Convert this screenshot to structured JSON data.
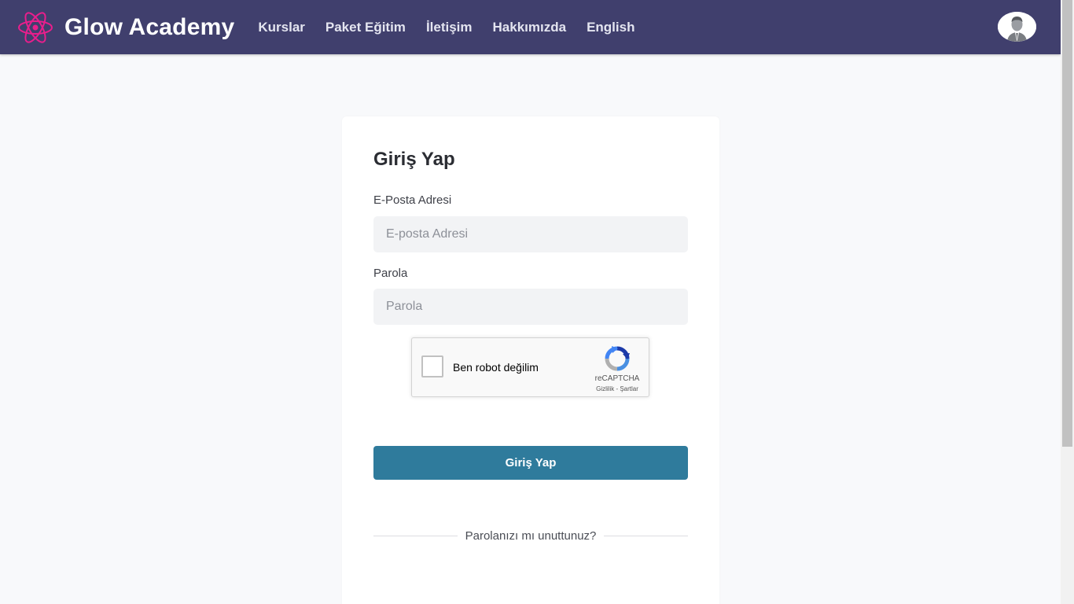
{
  "header": {
    "brand": "Glow Academy",
    "brand_color": "#e91e8c",
    "background": "#403f6d",
    "nav": [
      {
        "label": "Kurslar"
      },
      {
        "label": "Paket Eğitim"
      },
      {
        "label": "İletişim"
      },
      {
        "label": "Hakkımızda"
      },
      {
        "label": "English"
      }
    ],
    "avatar_icon": "user-avatar-icon"
  },
  "login": {
    "title": "Giriş Yap",
    "email_label": "E-Posta Adresi",
    "email_placeholder": "E-posta Adresi",
    "email_value": "",
    "password_label": "Parola",
    "password_placeholder": "Parola",
    "password_value": "",
    "submit_label": "Giriş Yap",
    "submit_color": "#2f7b9c",
    "forgot_label": "Parolanızı mı unuttunuz?"
  },
  "recaptcha": {
    "label": "Ben robot değilim",
    "brand": "reCAPTCHA",
    "terms": "Gizlilik - Şartlar",
    "checked": false
  }
}
